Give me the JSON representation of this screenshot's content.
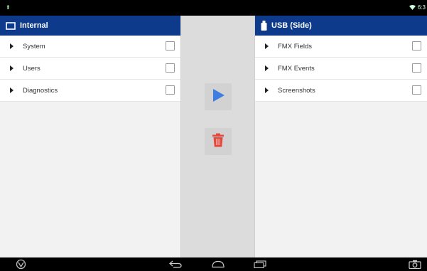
{
  "status_bar": {
    "time": "6:3"
  },
  "left_panel": {
    "title": "Internal",
    "items": [
      {
        "label": "System",
        "checked": false
      },
      {
        "label": "Users",
        "checked": false
      },
      {
        "label": "Diagnostics",
        "checked": false
      }
    ]
  },
  "right_panel": {
    "title": "USB (Side)",
    "items": [
      {
        "label": "FMX Fields",
        "checked": false
      },
      {
        "label": "FMX Events",
        "checked": false
      },
      {
        "label": "Screenshots",
        "checked": false
      }
    ]
  },
  "actions": {
    "transfer_icon": "play-arrow-icon",
    "delete_icon": "trash-icon"
  },
  "colors": {
    "header_bg": "#0d3a8a",
    "transfer_blue": "#3f7ee0",
    "delete_red": "#e5473a"
  }
}
